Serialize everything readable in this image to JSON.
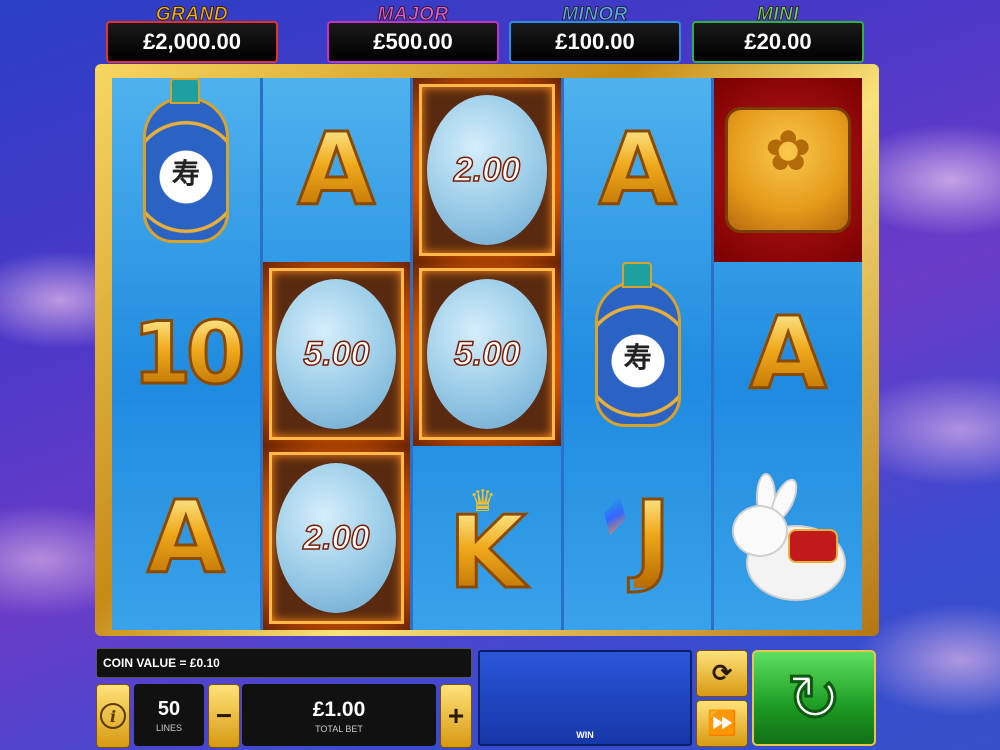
{
  "jackpots": {
    "grand": {
      "label": "GRAND",
      "value": "£2,000.00",
      "color": "#f2b21c"
    },
    "major": {
      "label": "MAJOR",
      "value": "£500.00",
      "color": "#e05be0"
    },
    "minor": {
      "label": "MINOR",
      "value": "£100.00",
      "color": "#4db3ff"
    },
    "mini": {
      "label": "MINI",
      "value": "£20.00",
      "color": "#6bd66b"
    }
  },
  "reels": {
    "r1": {
      "s1": "snuff-bottle",
      "s2": "10",
      "s3": "A"
    },
    "r2": {
      "s1": "A",
      "s2": "5.00",
      "s3": "2.00"
    },
    "r3": {
      "s1": "2.00",
      "s2": "5.00",
      "s3": "K"
    },
    "r4": {
      "s1": "A",
      "s2": "snuff-bottle",
      "s3": "J"
    },
    "r5": {
      "s1": "mooncake",
      "s2": "A",
      "s3": "rabbit"
    }
  },
  "controls": {
    "coin_value": "COIN VALUE = £0.10",
    "lines_value": "50",
    "lines_label": "LINES",
    "total_bet_value": "£1.00",
    "total_bet_label": "TOTAL BET",
    "minus": "−",
    "plus": "+",
    "win_label": "WIN",
    "info_glyph": "i",
    "autoplay_icon": "autoplay-icon",
    "turbo_icon": "fast-forward-icon",
    "spin_icon": "spin-arrow-icon"
  }
}
